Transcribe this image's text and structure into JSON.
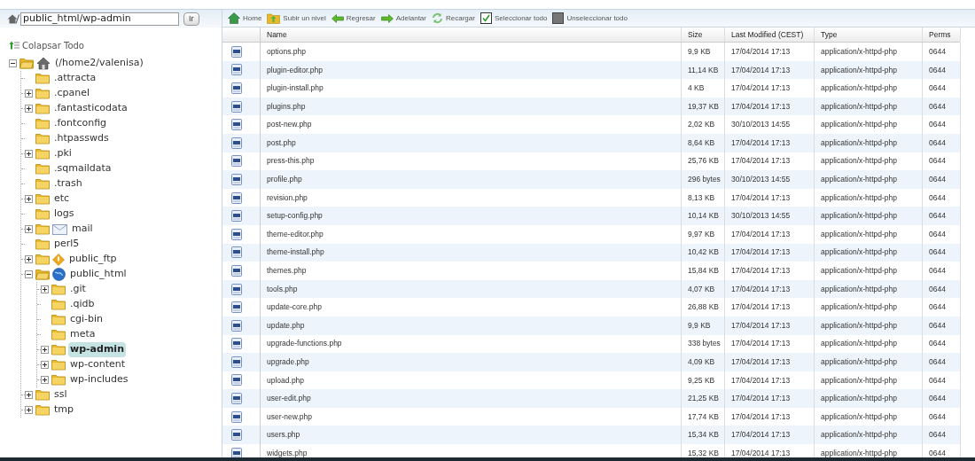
{
  "path_bar": {
    "value": "public_html/wp-admin",
    "go_button": "Ir"
  },
  "tree": {
    "collapse_all": "Colapsar Todo",
    "root": {
      "label": "(/home2/valenisa)",
      "kind": "home",
      "expanded": true,
      "selected": false,
      "children": [
        {
          "label": ".attracta",
          "kind": "folder",
          "expandable": false,
          "selected": false
        },
        {
          "label": ".cpanel",
          "kind": "folder",
          "expandable": true,
          "expanded": false,
          "selected": false
        },
        {
          "label": ".fantasticodata",
          "kind": "folder",
          "expandable": true,
          "expanded": false,
          "selected": false
        },
        {
          "label": ".fontconfig",
          "kind": "folder",
          "expandable": false,
          "selected": false
        },
        {
          "label": ".htpasswds",
          "kind": "folder",
          "expandable": false,
          "selected": false
        },
        {
          "label": ".pki",
          "kind": "folder",
          "expandable": true,
          "expanded": false,
          "selected": false
        },
        {
          "label": ".sqmaildata",
          "kind": "folder",
          "expandable": false,
          "selected": false
        },
        {
          "label": ".trash",
          "kind": "folder",
          "expandable": false,
          "selected": false
        },
        {
          "label": "etc",
          "kind": "folder",
          "expandable": true,
          "expanded": false,
          "selected": false
        },
        {
          "label": "logs",
          "kind": "folder",
          "expandable": false,
          "selected": false
        },
        {
          "label": "mail",
          "kind": "mail",
          "expandable": true,
          "expanded": false,
          "selected": false
        },
        {
          "label": "perl5",
          "kind": "folder",
          "expandable": false,
          "selected": false
        },
        {
          "label": "public_ftp",
          "kind": "ftp",
          "expandable": true,
          "expanded": false,
          "selected": false
        },
        {
          "label": "public_html",
          "kind": "globe",
          "expandable": true,
          "expanded": true,
          "selected": false,
          "children": [
            {
              "label": ".git",
              "kind": "folder",
              "expandable": true,
              "expanded": false,
              "selected": false
            },
            {
              "label": ".qidb",
              "kind": "folder",
              "expandable": false,
              "selected": false
            },
            {
              "label": "cgi-bin",
              "kind": "folder",
              "expandable": false,
              "selected": false
            },
            {
              "label": "meta",
              "kind": "folder",
              "expandable": false,
              "selected": false
            },
            {
              "label": "wp-admin",
              "kind": "folder",
              "expandable": true,
              "expanded": false,
              "selected": true
            },
            {
              "label": "wp-content",
              "kind": "folder",
              "expandable": true,
              "expanded": false,
              "selected": false
            },
            {
              "label": "wp-includes",
              "kind": "folder",
              "expandable": true,
              "expanded": false,
              "selected": false
            }
          ]
        },
        {
          "label": "ssl",
          "kind": "folder",
          "expandable": true,
          "expanded": false,
          "selected": false
        },
        {
          "label": "tmp",
          "kind": "folder",
          "expandable": true,
          "expanded": false,
          "selected": false
        }
      ]
    }
  },
  "toolbar": [
    {
      "label": "Home",
      "kind": "home"
    },
    {
      "label": "Subir un nivel",
      "kind": "up"
    },
    {
      "label": "Regresar",
      "kind": "back"
    },
    {
      "label": "Adelantar",
      "kind": "forward"
    },
    {
      "label": "Recargar",
      "kind": "reload"
    },
    {
      "label": "Seleccionar todo",
      "kind": "select_all"
    },
    {
      "label": "Unseleccionar todo",
      "kind": "unselect_all"
    }
  ],
  "table": {
    "columns": [
      "Name",
      "Size",
      "Last Modified (CEST)",
      "Type",
      "Perms"
    ],
    "rows": [
      [
        "options.php",
        "9,9 KB",
        "17/04/2014 17:13",
        "application/x-httpd-php",
        "0644"
      ],
      [
        "plugin-editor.php",
        "11,14 KB",
        "17/04/2014 17:13",
        "application/x-httpd-php",
        "0644"
      ],
      [
        "plugin-install.php",
        "4 KB",
        "17/04/2014 17:13",
        "application/x-httpd-php",
        "0644"
      ],
      [
        "plugins.php",
        "19,37 KB",
        "17/04/2014 17:13",
        "application/x-httpd-php",
        "0644"
      ],
      [
        "post-new.php",
        "2,02 KB",
        "30/10/2013 14:55",
        "application/x-httpd-php",
        "0644"
      ],
      [
        "post.php",
        "8,64 KB",
        "17/04/2014 17:13",
        "application/x-httpd-php",
        "0644"
      ],
      [
        "press-this.php",
        "25,76 KB",
        "17/04/2014 17:13",
        "application/x-httpd-php",
        "0644"
      ],
      [
        "profile.php",
        "296 bytes",
        "30/10/2013 14:55",
        "application/x-httpd-php",
        "0644"
      ],
      [
        "revision.php",
        "8,13 KB",
        "17/04/2014 17:13",
        "application/x-httpd-php",
        "0644"
      ],
      [
        "setup-config.php",
        "10,14 KB",
        "30/10/2013 14:55",
        "application/x-httpd-php",
        "0644"
      ],
      [
        "theme-editor.php",
        "9,97 KB",
        "17/04/2014 17:13",
        "application/x-httpd-php",
        "0644"
      ],
      [
        "theme-install.php",
        "10,42 KB",
        "17/04/2014 17:13",
        "application/x-httpd-php",
        "0644"
      ],
      [
        "themes.php",
        "15,84 KB",
        "17/04/2014 17:13",
        "application/x-httpd-php",
        "0644"
      ],
      [
        "tools.php",
        "4,07 KB",
        "17/04/2014 17:13",
        "application/x-httpd-php",
        "0644"
      ],
      [
        "update-core.php",
        "26,88 KB",
        "17/04/2014 17:13",
        "application/x-httpd-php",
        "0644"
      ],
      [
        "update.php",
        "9,9 KB",
        "17/04/2014 17:13",
        "application/x-httpd-php",
        "0644"
      ],
      [
        "upgrade-functions.php",
        "338 bytes",
        "17/04/2014 17:13",
        "application/x-httpd-php",
        "0644"
      ],
      [
        "upgrade.php",
        "4,09 KB",
        "17/04/2014 17:13",
        "application/x-httpd-php",
        "0644"
      ],
      [
        "upload.php",
        "9,25 KB",
        "17/04/2014 17:13",
        "application/x-httpd-php",
        "0644"
      ],
      [
        "user-edit.php",
        "21,25 KB",
        "17/04/2014 17:13",
        "application/x-httpd-php",
        "0644"
      ],
      [
        "user-new.php",
        "17,74 KB",
        "17/04/2014 17:13",
        "application/x-httpd-php",
        "0644"
      ],
      [
        "users.php",
        "15,34 KB",
        "17/04/2014 17:13",
        "application/x-httpd-php",
        "0644"
      ],
      [
        "widgets.php",
        "15,32 KB",
        "17/04/2014 17:13",
        "application/x-httpd-php",
        "0644"
      ]
    ]
  }
}
